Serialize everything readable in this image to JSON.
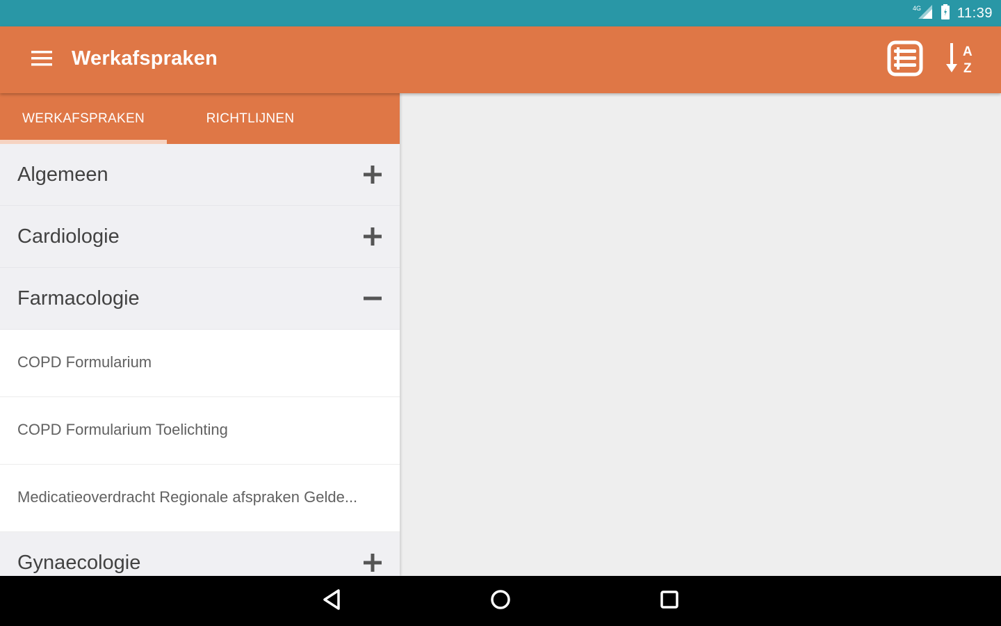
{
  "status_bar": {
    "time": "11:39",
    "icons": [
      "signal-4g-icon",
      "battery-icon"
    ]
  },
  "app_bar": {
    "title": "Werkafspraken",
    "actions": [
      "list-view-icon",
      "sort-alpha-icon"
    ]
  },
  "tabs": [
    {
      "label": "WERKAFSPRAKEN",
      "active": true
    },
    {
      "label": "RICHTLIJNEN",
      "active": false
    }
  ],
  "groups": [
    {
      "label": "Algemeen",
      "expanded": false,
      "items": []
    },
    {
      "label": "Cardiologie",
      "expanded": false,
      "items": []
    },
    {
      "label": "Farmacologie",
      "expanded": true,
      "items": [
        {
          "label": "COPD Formularium"
        },
        {
          "label": "COPD Formularium Toelichting"
        },
        {
          "label": "Medicatieoverdracht Regionale afspraken Gelde..."
        }
      ]
    },
    {
      "label": "Gynaecologie",
      "expanded": false,
      "items": []
    }
  ],
  "nav_bar": {
    "buttons": [
      "back-icon",
      "home-icon",
      "recents-icon"
    ]
  },
  "colors": {
    "status_bar": "#2997a6",
    "app_bar": "#df7746",
    "tab_indicator": "#f6d3c1",
    "group_bg": "#f0f0f3",
    "child_bg": "#ffffff",
    "content_bg": "#eeeeee"
  }
}
